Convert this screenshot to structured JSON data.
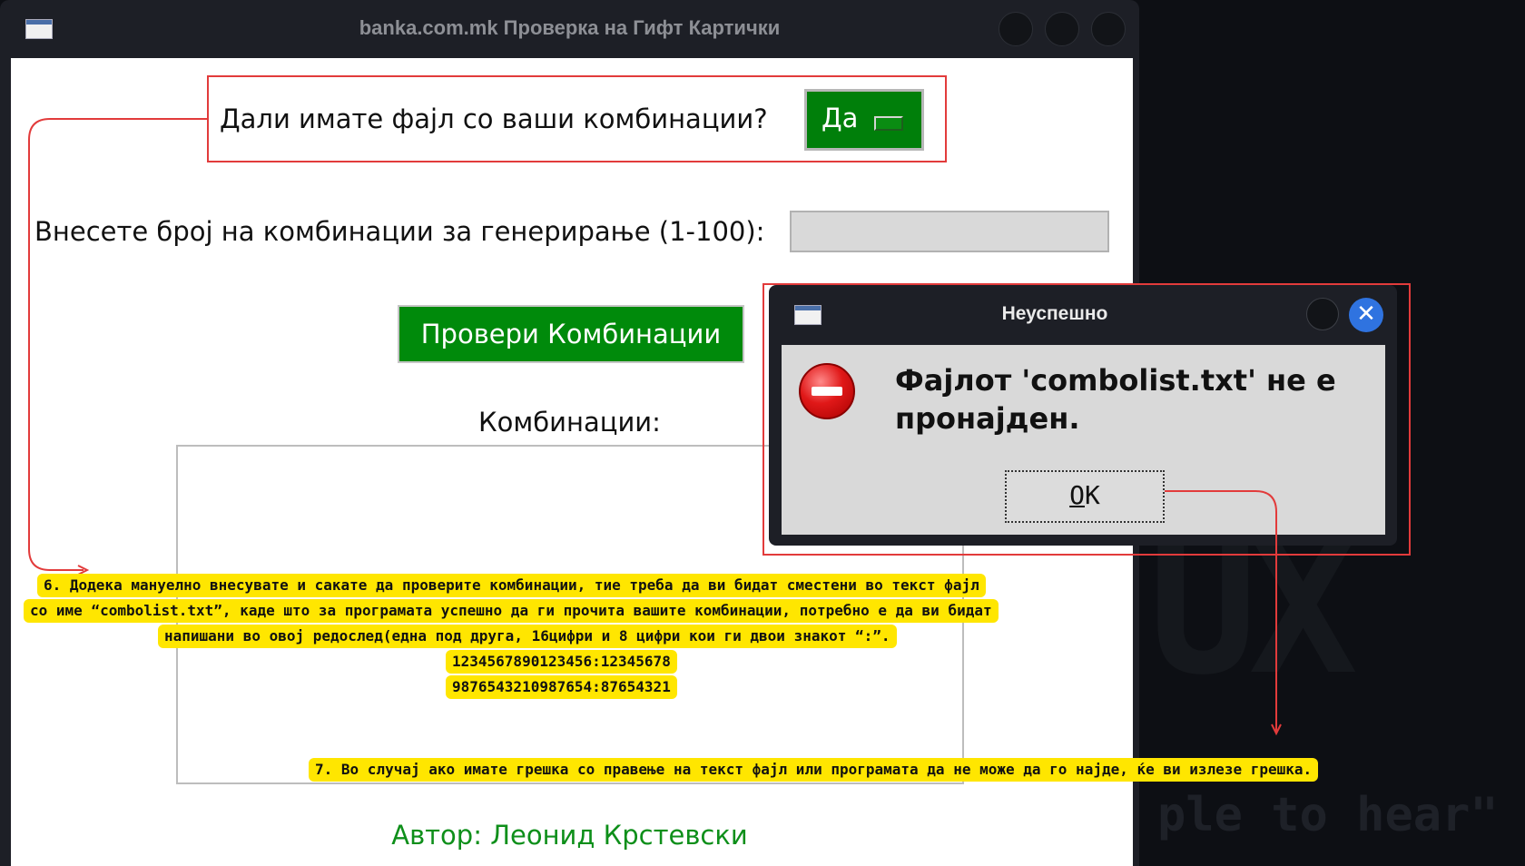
{
  "main_window": {
    "title": "banka.com.mk Проверка на Гифт Картички",
    "file_question": "Дали имате фајл со ваши комбинации?",
    "file_toggle": "Да",
    "count_label": "Внесете број на комбинации за генерирање (1-100):",
    "count_value": "",
    "check_button": "Провери Комбинации",
    "combinations_label": "Комбинации:",
    "author": "Автор: Леонид Крстевски"
  },
  "dialog": {
    "title": "Неуспешно",
    "close_glyph": "✕",
    "message": "Фајлот 'combolist.txt' не е пронајден.",
    "ok_accel": "O",
    "ok_rest": "K"
  },
  "annotations": {
    "note6_line1": "6. Додека мануелно внесувате и сакате да проверите комбинации, тие треба да ви бидат сместени во текст фајл",
    "note6_line2": "со име “combolist.txt”, каде што за програмата успешно да ги прочита вашите комбинации, потребно е да ви бидат",
    "note6_line3": "напишани во овој редослед(една под друга, 16цифри и 8 цифри кои ги двои знакот “:”.",
    "example1": "1234567890123456:12345678",
    "example2": "9876543210987654:87654321",
    "note7": "7. Во случај ако имате грешка со правење на текст фајл или програмата  да не може да го најде, ќе ви излезе грешка."
  },
  "background": {
    "big_text": "UX",
    "quote": "ple to hear\""
  },
  "colors": {
    "accent_green": "#008a0b",
    "author_green": "#0e8f1a",
    "annotation_red": "#e23b3b",
    "annotation_yellow": "#ffe600",
    "dialog_close_blue": "#2f73e0"
  }
}
